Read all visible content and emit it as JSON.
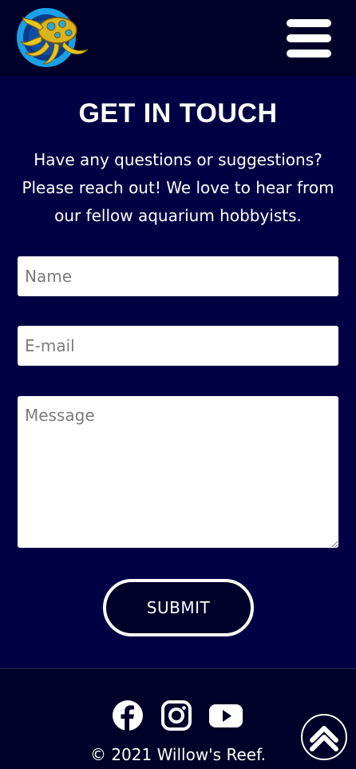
{
  "header": {
    "logo_icon": "octopus-logo-icon",
    "menu_icon": "hamburger-menu-icon"
  },
  "contact": {
    "title": "GET IN TOUCH",
    "intro": "Have any questions or suggestions? Please reach out! We love to hear from our fellow aquarium hobbyists.",
    "name_placeholder": "Name",
    "email_placeholder": "E-mail",
    "message_placeholder": "Message",
    "submit_label": "SUBMIT"
  },
  "footer": {
    "social": [
      "facebook-icon",
      "instagram-icon",
      "youtube-icon"
    ],
    "copyright": "© 2021 Willow's Reef.",
    "scroll_top_icon": "chevron-up-icon"
  },
  "colors": {
    "background": "#000044",
    "header_footer": "#000028",
    "text": "#ffffff",
    "logo_blue": "#1aa0e6",
    "logo_yellow": "#e8c520"
  }
}
